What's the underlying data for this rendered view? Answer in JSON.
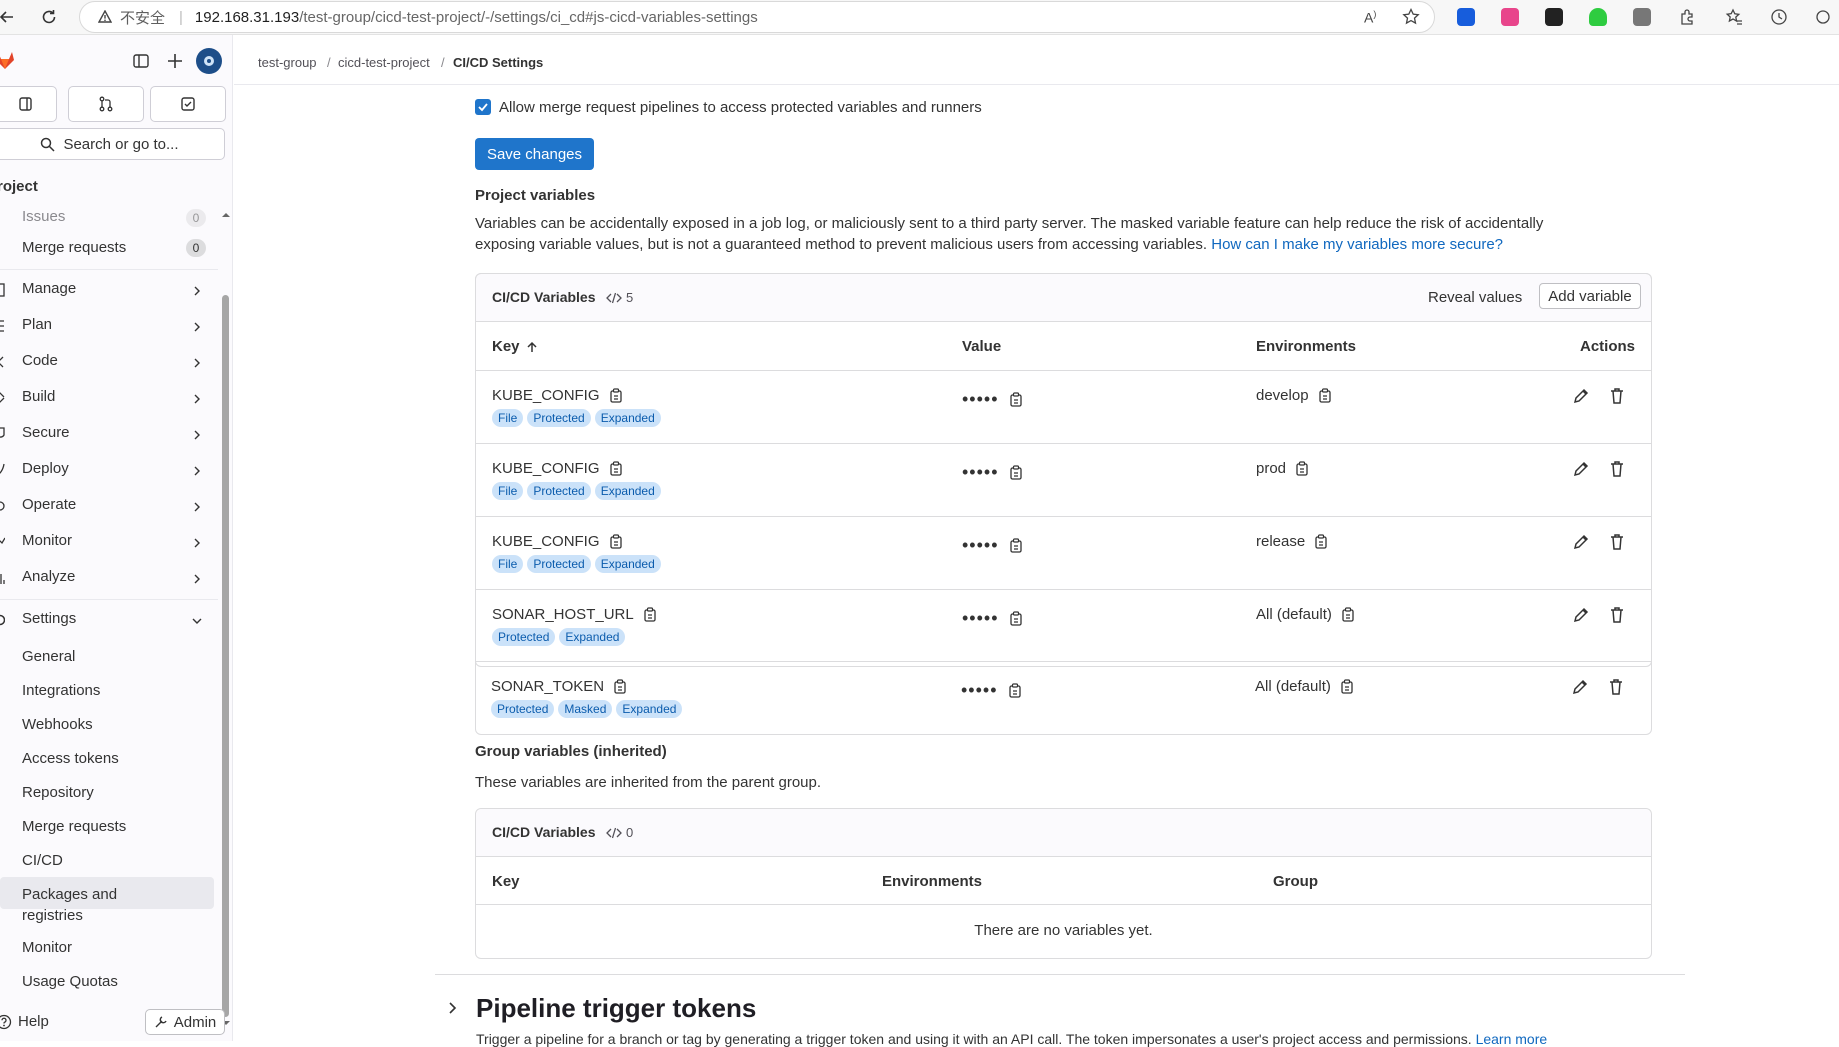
{
  "browser": {
    "insecure_label": "不安全",
    "url_host": "192.168.31.193",
    "url_path": "/test-group/cicd-test-project/-/settings/ci_cd#js-cicd-variables-settings"
  },
  "sidebar": {
    "search_label": "Search or go to...",
    "project_title": "roject",
    "items": [
      {
        "label": "Issues",
        "count": "0"
      },
      {
        "label": "Merge requests",
        "count": "0"
      },
      {
        "label": "Manage"
      },
      {
        "label": "Plan"
      },
      {
        "label": "Code"
      },
      {
        "label": "Build"
      },
      {
        "label": "Secure"
      },
      {
        "label": "Deploy"
      },
      {
        "label": "Operate"
      },
      {
        "label": "Monitor"
      },
      {
        "label": "Analyze"
      },
      {
        "label": "Settings"
      }
    ],
    "settings_items": [
      "General",
      "Integrations",
      "Webhooks",
      "Access tokens",
      "Repository",
      "Merge requests",
      "CI/CD",
      "Packages and registries",
      "Monitor",
      "Usage Quotas"
    ],
    "active_item": "CI/CD",
    "help_label": "Help",
    "admin_label": "Admin"
  },
  "breadcrumb": {
    "items": [
      "test-group",
      "cicd-test-project",
      "CI/CD Settings"
    ]
  },
  "settings": {
    "checkbox_label": "Allow merge request pipelines to access protected variables and runners",
    "checkbox_checked": true,
    "save_label": "Save changes",
    "project_vars_heading": "Project variables",
    "project_vars_desc": "Variables can be accidentally exposed in a job log, or maliciously sent to a third party server. The masked variable feature can help reduce the risk of accidentally exposing variable values, but is not a guaranteed method to prevent malicious users from accessing variables.",
    "project_vars_link": "How can I make my variables more secure?"
  },
  "project_vars_card": {
    "title": "CI/CD Variables",
    "count": "5",
    "reveal_label": "Reveal values",
    "add_label": "Add variable",
    "headers": {
      "key": "Key",
      "value": "Value",
      "environments": "Environments",
      "actions": "Actions"
    },
    "rows": [
      {
        "key": "KUBE_CONFIG",
        "badges": [
          "File",
          "Protected",
          "Expanded"
        ],
        "value": "•••••",
        "env": "develop"
      },
      {
        "key": "KUBE_CONFIG",
        "badges": [
          "File",
          "Protected",
          "Expanded"
        ],
        "value": "•••••",
        "env": "prod"
      },
      {
        "key": "KUBE_CONFIG",
        "badges": [
          "File",
          "Protected",
          "Expanded"
        ],
        "value": "•••••",
        "env": "release"
      },
      {
        "key": "SONAR_HOST_URL",
        "badges": [
          "Protected",
          "Expanded"
        ],
        "value": "•••••",
        "env": "All (default)"
      },
      {
        "key": "SONAR_TOKEN",
        "badges": [
          "Protected",
          "Masked",
          "Expanded"
        ],
        "value": "•••••",
        "env": "All (default)"
      }
    ]
  },
  "group_vars": {
    "heading": "Group variables (inherited)",
    "desc": "These variables are inherited from the parent group.",
    "card_title": "CI/CD Variables",
    "count": "0",
    "headers": {
      "key": "Key",
      "environments": "Environments",
      "group": "Group"
    },
    "empty": "There are no variables yet."
  },
  "pipeline_triggers": {
    "title": "Pipeline trigger tokens",
    "desc": "Trigger a pipeline for a branch or tag by generating a trigger token and using it with an API call. The token impersonates a user's project access and permissions.",
    "link": "Learn more"
  },
  "colors": {
    "primary": "#1f75cb",
    "badge_bg": "#cbe2f9",
    "badge_text": "#0b5cad",
    "link": "#1068bf"
  }
}
